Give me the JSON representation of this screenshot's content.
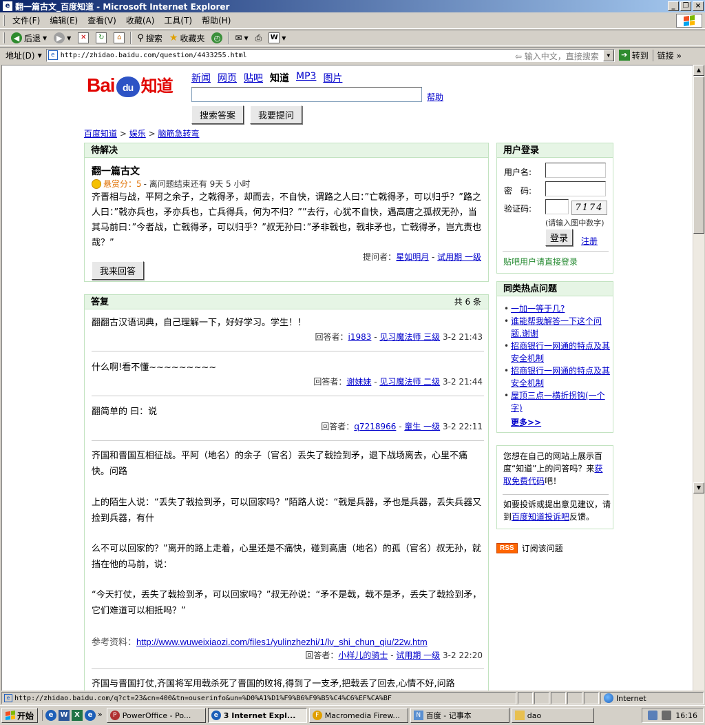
{
  "window": {
    "title": "翻一篇古文_百度知道 - Microsoft Internet Explorer",
    "controls": [
      "_",
      "❐",
      "×"
    ]
  },
  "menu": [
    "文件(F)",
    "编辑(E)",
    "查看(V)",
    "收藏(A)",
    "工具(T)",
    "帮助(H)"
  ],
  "toolbar": {
    "back": "后退",
    "search": "搜索",
    "favorites": "收藏夹"
  },
  "address": {
    "label": "地址(D)",
    "url": "http://zhidao.baidu.com/question/4433255.html",
    "cn_search": "输入中文，直接搜索",
    "go": "转到",
    "links": "链接"
  },
  "site": {
    "logo_bai": "Bai",
    "logo_du": "du",
    "logo_zhidao": "知道",
    "nav": [
      "新闻",
      "网页",
      "贴吧",
      "知道",
      "MP3",
      "图片"
    ],
    "help": "帮助",
    "search_btn": "搜索答案",
    "ask_btn": "我要提问",
    "breadcrumb": [
      "百度知道",
      "娱乐",
      "脑筋急转弯"
    ],
    "crumb_sep": ">"
  },
  "question": {
    "header": "待解决",
    "title": "翻一篇古文",
    "reward_label": "悬赏分：5",
    "time_left": " - 离问题结束还有 9天 5 小时",
    "body": "齐晋相与战，平阿之余子，之戟得矛，却而去，不自快，谓路之人曰：”亡戟得矛，可以归乎？”路之人曰：”戟亦兵也，矛亦兵也，亡兵得兵，何为不归？””去行，心犹不自快，遇高唐之孤叔无孙，当其马前曰：”今者战，亡戟得矛，可以归乎？”叔无孙曰：”矛非戟也，戟非矛也，亡戟得矛，岂亢责也哉？”",
    "asker_label": "提问者：",
    "asker": "星如明月",
    "asker_level": "试用期 一级",
    "answer_btn": "我来回答"
  },
  "answers": {
    "header": "答复",
    "count": "共 6 条",
    "by_label": "回答者：",
    "items": [
      {
        "text": "翻翻古汉语词典，自己理解一下，好好学习。学生！！",
        "user": "i1983",
        "level": "见习魔法师 三级",
        "time": "3-2 21:43"
      },
      {
        "text": "什么啊!看不懂~~~~~~~~~",
        "user": "谢妹妹",
        "level": "见习魔法师 二级",
        "time": "3-2 21:44"
      },
      {
        "text": "翻简单的 曰：说",
        "user": "q7218966",
        "level": "童生 一级",
        "time": "3-2 22:11"
      },
      {
        "paragraphs": [
          "齐国和晋国互相征战。平阿（地名）的余子（官名）丢失了戟捡到矛，退下战场离去，心里不痛快。问路",
          "上的陌生人说：“丢失了戟捡到矛，可以回家吗？”陌路人说：“戟是兵器，矛也是兵器，丢失兵器又捡到兵器，有什",
          "么不可以回家的？”离开的路上走着，心里还是不痛快，碰到高唐（地名）的孤（官名）叔无孙，就挡在他的马前，说：",
          "“今天打仗，丢失了戟捡到矛，可以回家吗？”叔无孙说：“矛不是戟，戟不是矛，丢失了戟捡到矛，它们难道可以相抵吗？”"
        ],
        "ref_label": "参考资料：",
        "ref_url": "http://www.wuweixiaozi.com/files1/yulinzhezhi/1/lv_shi_chun_qiu/22w.htm",
        "user": "小样儿的骑士",
        "level": "试用期 一级",
        "time": "3-2 22:20"
      },
      {
        "text": "齐国与晋国打仗,齐国将军用戟杀死了晋国的败将,得到了一支矛,把戟丢了回去,心情不好,问路"
      }
    ]
  },
  "login": {
    "header": "用户登录",
    "username": "用户名:",
    "password": "密　码:",
    "captcha_label": "验证码:",
    "captcha_text": "7174",
    "captcha_tip": "(请输入图中数字)",
    "login_btn": "登录",
    "register": "注册",
    "tieba": "贴吧用户请直接登录"
  },
  "hot": {
    "header": "同类热点问题",
    "items": [
      "一加一等于几?",
      "谁能帮我解答一下这个问题,谢谢",
      "招商银行一网通的特点及其安全机制",
      "招商银行一网通的特点及其安全机制",
      "屋顶三点一横折拐钩(一个字)"
    ],
    "more": "更多>>"
  },
  "promo": {
    "text1_pre": "您想在自己的网站上展示百度“知道”上的问答吗？来",
    "text1_link": "获取免费代码",
    "text1_post": "吧！",
    "text2_pre": "如要投诉或提出意见建议，请到",
    "text2_link": "百度知道投诉吧",
    "text2_post": "反馈。"
  },
  "rss": {
    "badge": "RSS",
    "label": "订阅该问题"
  },
  "status": {
    "url": "http://zhidao.baidu.com/q?ct=23&cn=400&tn=ouserinfo&un=%D0%A1%D1%F9%B6%F9%B5%C4%C6%EF%CA%BF",
    "zone": "Internet"
  },
  "taskbar": {
    "start": "开始",
    "tasks": [
      "PowerOffice - Po...",
      "3 Internet Expl...",
      "Macromedia Firew...",
      "百度 - 记事本",
      "dao"
    ],
    "clock": "16:16"
  },
  "colors": {
    "title_bar": "#0a246a",
    "box_header": "#e6f5e5",
    "box_border": "#c2e3c0",
    "link": "#0000cc",
    "baidu_red": "#e10602",
    "baidu_blue": "#2d53c5"
  }
}
